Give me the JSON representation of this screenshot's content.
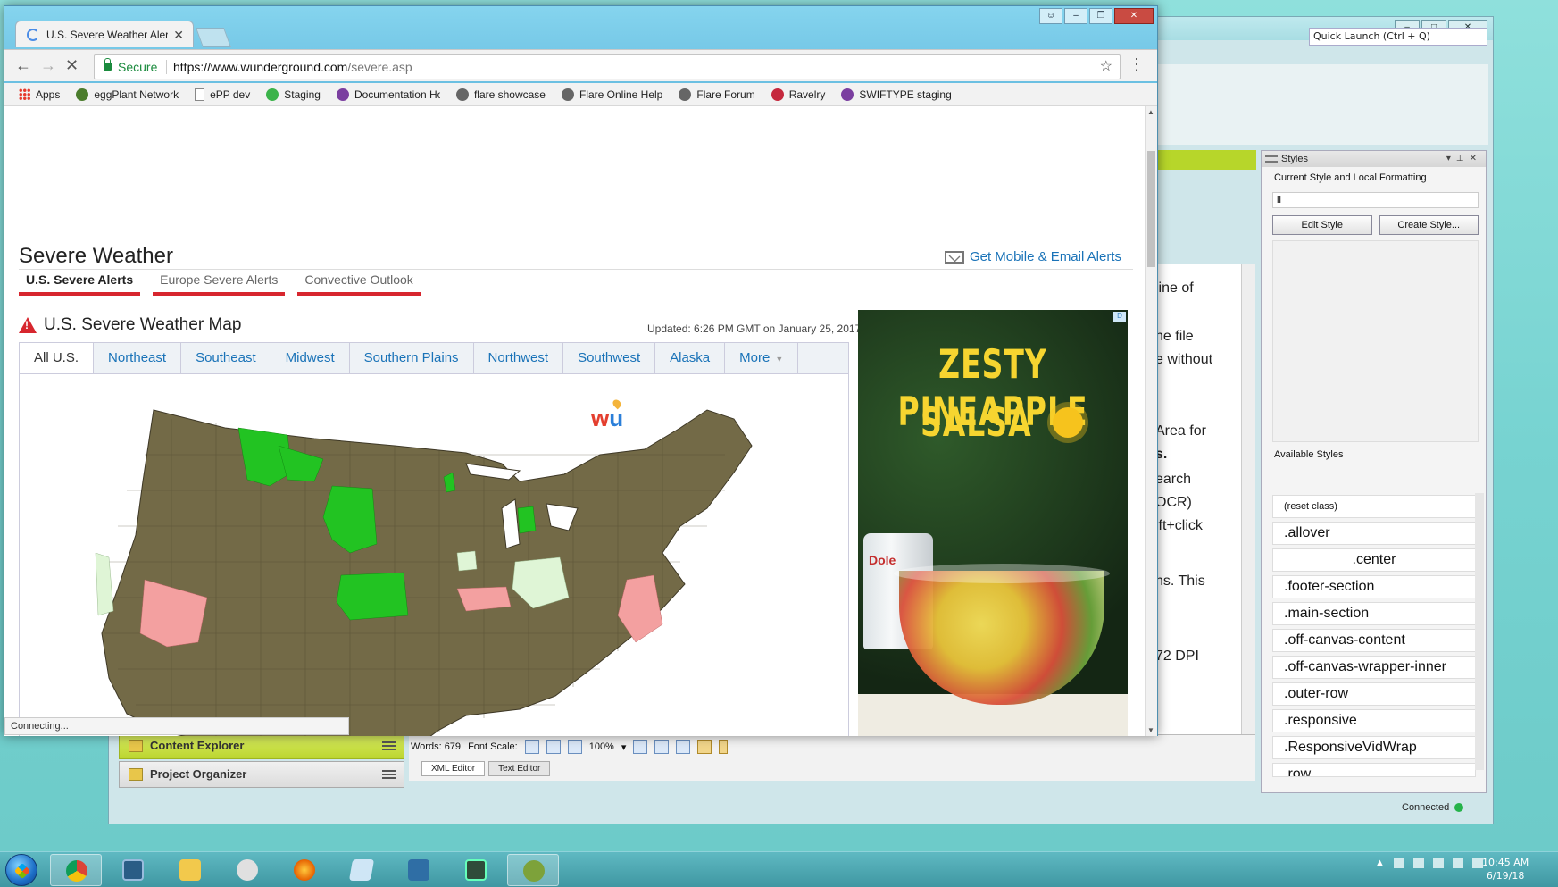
{
  "flare": {
    "quick_launch": "Quick Launch (Ctrl + Q)",
    "doc_fragments": [
      "line of",
      "he file",
      "e without",
      "Area for",
      "s.",
      "earch",
      "OCR)",
      "ift+click",
      "ns. This",
      "72 DPI"
    ],
    "styles_panel": {
      "title": "Styles",
      "current_label": "Current Style and Local Formatting",
      "current_value": "li",
      "edit_button": "Edit Style",
      "create_button": "Create Style...",
      "available_label": "Available Styles",
      "items": [
        "(reset class)",
        ".allover",
        ".center",
        ".footer-section",
        ".main-section",
        ".off-canvas-content",
        ".off-canvas-wrapper-inner",
        ".outer-row",
        ".responsive",
        ".ResponsiveVidWrap",
        ".row"
      ]
    },
    "panes": {
      "content_explorer": "Content Explorer",
      "project_organizer": "Project Organizer"
    },
    "status_bar": {
      "words": "Words: 679",
      "font_scale_label": "Font Scale:",
      "zoom": "100%",
      "xml_editor_tab": "XML Editor",
      "text_editor_tab": "Text Editor",
      "connection": "Connected"
    }
  },
  "browser": {
    "tab_title": "U.S. Severe Weather Alerts",
    "secure_label": "Secure",
    "url_host": "https://www.wunderground.com",
    "url_path": "/severe.asp",
    "bookmarks": [
      "Apps",
      "eggPlant Network",
      "ePP dev",
      "Staging",
      "Documentation Hom",
      "flare showcase",
      "Flare Online Help",
      "Flare Forum",
      "Ravelry",
      "SWIFTYPE staging"
    ],
    "status_text": "Connecting..."
  },
  "page": {
    "heading": "Severe Weather",
    "mobile_alerts_link": "Get Mobile & Email Alerts",
    "subtabs": [
      "U.S. Severe Alerts",
      "Europe Severe Alerts",
      "Convective Outlook"
    ],
    "map_title": "U.S. Severe Weather Map",
    "updated": "Updated: 6:26 PM GMT on January 25, 2017",
    "region_tabs": [
      "All U.S.",
      "Northeast",
      "Southeast",
      "Midwest",
      "Southern Plains",
      "Northwest",
      "Southwest",
      "Alaska",
      "More"
    ],
    "logo_w": "w",
    "logo_u": "u"
  },
  "ad": {
    "line1": "ZESTY PINEAPPLE",
    "line2": "SALSA",
    "brand": "Dole",
    "badge": "D"
  },
  "colors": {
    "map_land": "#736a47",
    "alert_green": "#22c322",
    "alert_pink": "#f3a0a0",
    "alert_pale": "#dff5d6",
    "accent_red": "#d7262e",
    "link_blue": "#1a73b8"
  },
  "taskbar": {
    "time": "10:45 AM",
    "date": "6/19/18"
  }
}
